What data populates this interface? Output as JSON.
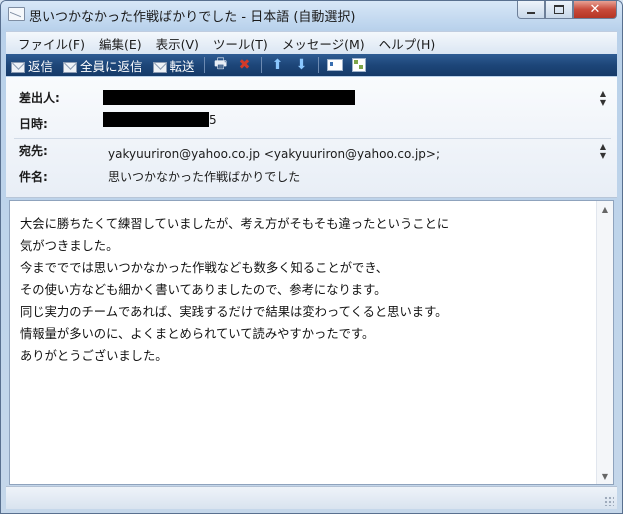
{
  "window": {
    "title": "思いつかなかった作戦ばかりでした - 日本語 (自動選択)",
    "minimize_icon": "minimize-icon",
    "maximize_icon": "maximize-icon",
    "close_glyph": "✕"
  },
  "menu": {
    "items": [
      "ファイル(F)",
      "編集(E)",
      "表示(V)",
      "ツール(T)",
      "メッセージ(M)",
      "ヘルプ(H)"
    ]
  },
  "toolbar": {
    "reply_label": "返信",
    "reply_all_label": "全員に返信",
    "forward_label": "転送",
    "print_glyph": "🖶",
    "delete_glyph": "✖",
    "up_glyph": "⬆",
    "down_glyph": "⬇",
    "colors": {
      "bg": "#1d4679",
      "delete": "#d23a2a",
      "arrows": "#8cc8ff"
    }
  },
  "header": {
    "from_label": "差出人:",
    "date_label": "日時:",
    "date_visible": "5",
    "to_label": "宛先:",
    "to_value": "yakyuuriron@yahoo.co.jp <yakyuuriron@yahoo.co.jp>;",
    "subject_label": "件名:",
    "subject_value": "思いつかなかった作戦ばかりでした"
  },
  "body": {
    "lines": [
      "大会に勝ちたくて練習していましたが、考え方がそもそも違ったということに",
      "気がつきました。",
      "今までででは思いつかなかった作戦なども数多く知ることができ、",
      "その使い方なども細かく書いてありましたので、参考になります。",
      "同じ実力のチームであれば、実践するだけで結果は変わってくると思います。",
      "情報量が多いのに、よくまとめられていて読みやすかったです。",
      "ありがとうございました。"
    ]
  }
}
